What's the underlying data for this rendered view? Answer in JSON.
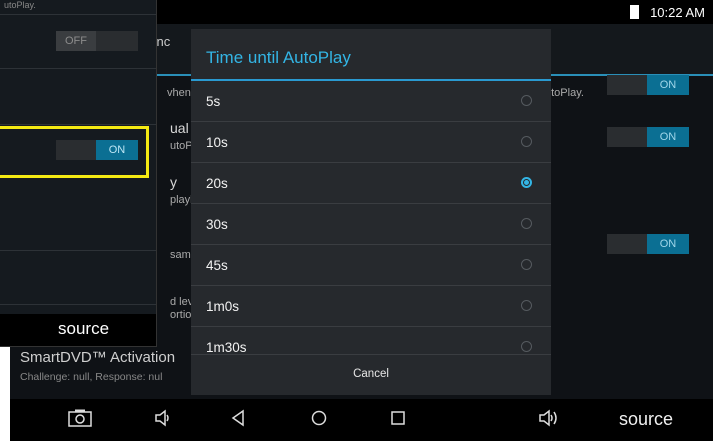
{
  "status_bar": {
    "time": "10:22 AM"
  },
  "background": {
    "title_fragment": "renc",
    "row_fragments": [
      "vhen",
      "ual",
      "utoP",
      "y",
      "playl",
      "sam",
      "d lev",
      "ortio"
    ],
    "right_text": "utoPlay.",
    "toggle_label": "ON",
    "smartdvd_title": "SmartDVD™ Activation",
    "smartdvd_subtitle": "Challenge: null, Response: nul"
  },
  "inset": {
    "header_fragment": "utoPlay.",
    "off_label": "OFF",
    "on_label": "ON",
    "source_label": "source"
  },
  "dialog": {
    "title": "Time until AutoPlay",
    "options": [
      {
        "label": "5s",
        "selected": false
      },
      {
        "label": "10s",
        "selected": false
      },
      {
        "label": "20s",
        "selected": true
      },
      {
        "label": "30s",
        "selected": false
      },
      {
        "label": "45s",
        "selected": false
      },
      {
        "label": "1m0s",
        "selected": false
      },
      {
        "label": "1m30s",
        "selected": false
      }
    ],
    "cancel_label": "Cancel"
  },
  "navbar": {
    "source_label": "source",
    "icons": [
      "screenshot-icon",
      "volume-down-icon",
      "back-icon",
      "home-icon",
      "recents-icon",
      "volume-up-icon"
    ]
  },
  "colors": {
    "accent": "#33b5e5",
    "toggle_on": "#0b6f93",
    "highlight": "#f4ea13"
  }
}
